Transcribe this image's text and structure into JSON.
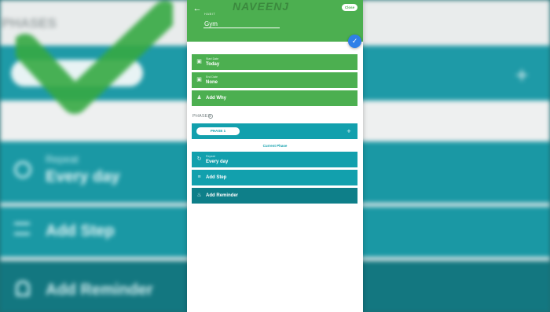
{
  "background": {
    "phases_label": "PHASES",
    "repeat_label": "Repeat",
    "repeat_value": "Every day",
    "add_step_label": "Add Step",
    "add_reminder_label": "Add Reminder",
    "plus_icon": "+"
  },
  "header": {
    "watermark": "NAVEENJ",
    "close_label": "Close",
    "habit_field_label": "HABIT",
    "habit_value": "Gym",
    "back_icon": "arrow-left-icon",
    "save_icon": "check-icon"
  },
  "details": {
    "start_date_label": "Start Date",
    "start_date_value": "Today",
    "end_date_label": "End Date",
    "end_date_value": "None",
    "add_why_label": "Add Why"
  },
  "phases": {
    "title": "PHASES",
    "phase_pill_label": "PHASE 1",
    "current_phase_label": "Current Phase",
    "add_phase_icon": "plus-icon"
  },
  "phase_settings": {
    "repeat_label": "Repeat",
    "repeat_value": "Every day",
    "add_step_label": "Add Step",
    "add_reminder_label": "Add Reminder"
  },
  "colors": {
    "header_green": "#4caf50",
    "teal": "#12a0ad",
    "teal_dark": "#0e7f89",
    "fab_blue": "#2f80e8"
  }
}
